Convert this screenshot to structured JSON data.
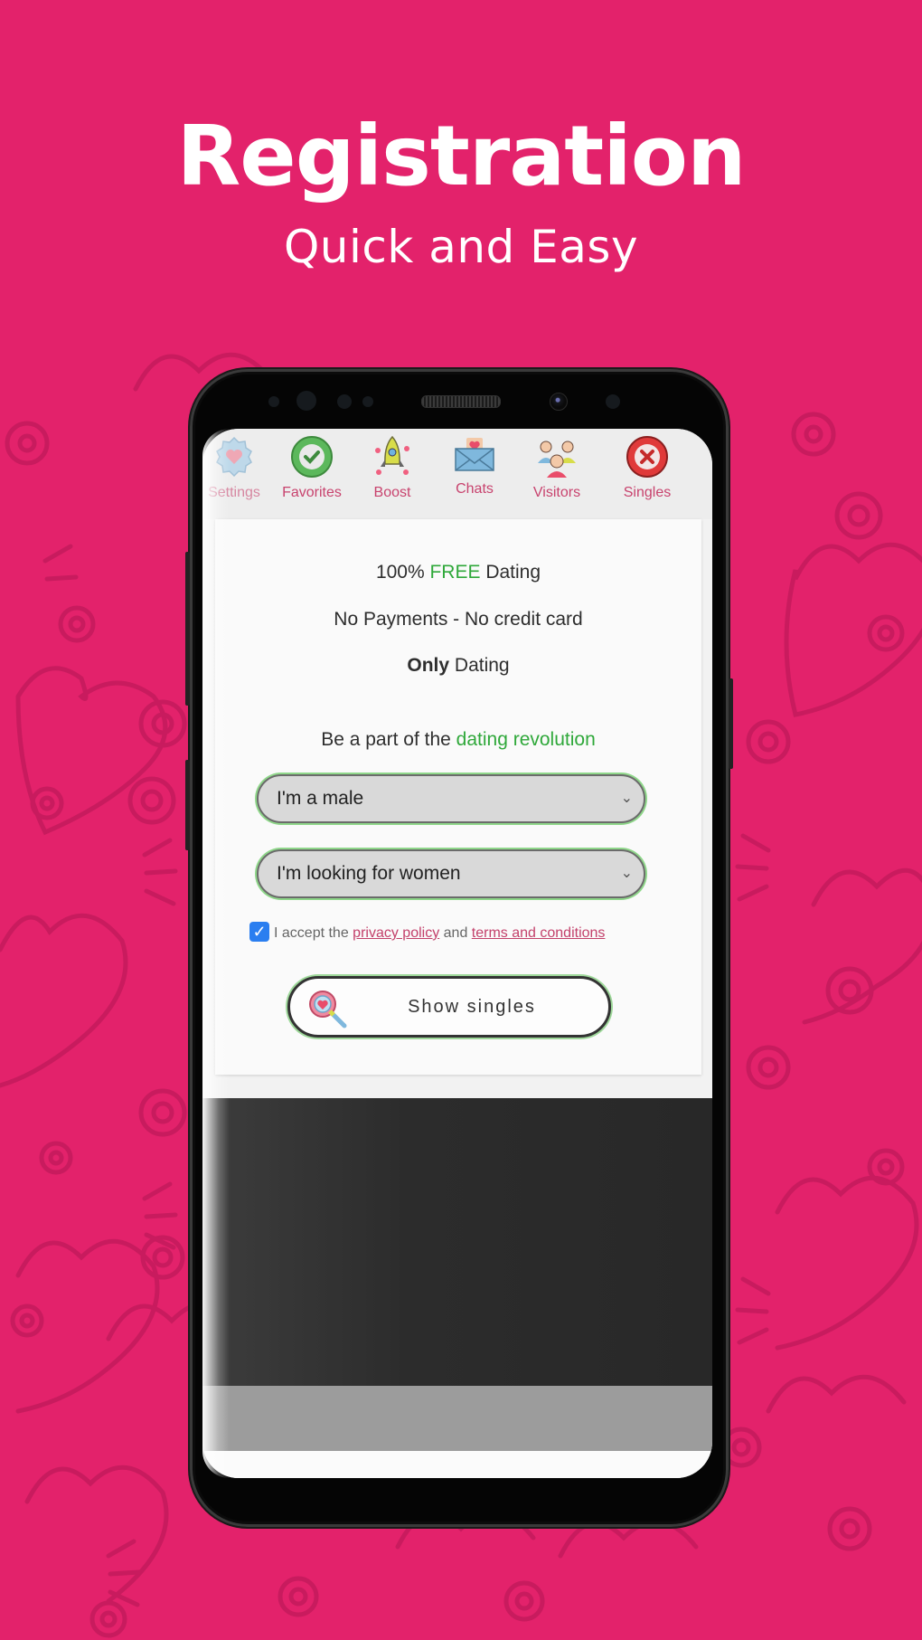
{
  "promo": {
    "title": "Registration",
    "subtitle": "Quick and Easy"
  },
  "colors": {
    "background": "#e3226b",
    "accent_green": "#2fa83a",
    "nav_label": "#c8436e",
    "link": "#c3416b",
    "checkbox": "#2a7ef0"
  },
  "nav": {
    "items": [
      {
        "label": "Settings",
        "icon": "settings-heart-icon"
      },
      {
        "label": "Favorites",
        "icon": "check-circle-icon"
      },
      {
        "label": "Boost",
        "icon": "rocket-icon"
      },
      {
        "label": "Chats",
        "icon": "envelope-heart-icon"
      },
      {
        "label": "Visitors",
        "icon": "people-icon"
      },
      {
        "label": "Singles",
        "icon": "close-circle-icon"
      }
    ]
  },
  "card": {
    "line1": {
      "prefix": "100% ",
      "highlight": "FREE",
      "suffix": " Dating"
    },
    "line2": "No Payments - No credit card",
    "line3": {
      "bold": "Only",
      "rest": " Dating"
    },
    "tagline": {
      "prefix": "Be a part of the ",
      "highlight": "dating revolution"
    },
    "gender_select": {
      "value": "I'm a male"
    },
    "seeking_select": {
      "value": "I'm looking for women"
    },
    "accept": {
      "checked": true,
      "prefix": "I accept the ",
      "privacy_link": "privacy policy",
      "middle": " and ",
      "terms_link": "terms and conditions"
    },
    "show_button": {
      "label": "Show singles",
      "icon": "heart-magnifier-icon"
    }
  }
}
